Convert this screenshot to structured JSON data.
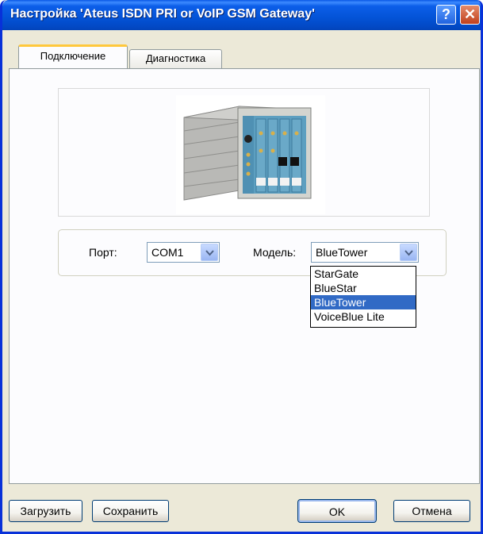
{
  "window": {
    "title": "Настройка 'Ateus ISDN PRI or VoIP GSM Gateway'",
    "help_label": "?",
    "close_label": "✕"
  },
  "tabs": [
    {
      "label": "Подключение",
      "active": true
    },
    {
      "label": "Диагностика",
      "active": false
    }
  ],
  "image": {
    "icon": "gateway-device-image"
  },
  "port": {
    "label": "Порт:",
    "value": "COM1"
  },
  "model": {
    "label": "Модель:",
    "value": "BlueTower",
    "options": [
      "StarGate",
      "BlueStar",
      "BlueTower",
      "VoiceBlue Lite"
    ],
    "selected_index": 2
  },
  "buttons": {
    "load": "Загрузить",
    "save": "Сохранить",
    "ok": "OK",
    "cancel": "Отмена"
  },
  "colors": {
    "titlebar": "#0353d6",
    "selection": "#316ac5",
    "tab_highlight": "#ffc83c",
    "dialog_bg": "#ece9d8"
  }
}
